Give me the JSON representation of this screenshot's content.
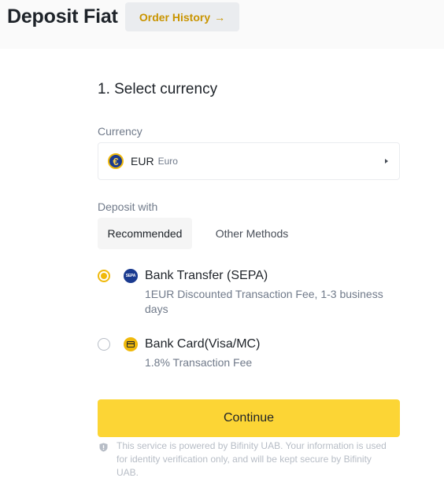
{
  "header": {
    "title": "Deposit Fiat",
    "order_history_label": "Order History",
    "order_history_arrow": "→"
  },
  "section": {
    "title": "1. Select currency"
  },
  "currency": {
    "label": "Currency",
    "coin_symbol": "€",
    "code": "EUR",
    "name": "Euro"
  },
  "deposit_with": {
    "label": "Deposit with",
    "tabs": [
      {
        "label": "Recommended",
        "active": true
      },
      {
        "label": "Other Methods",
        "active": false
      }
    ]
  },
  "methods": [
    {
      "icon": "sepa-icon",
      "icon_text": "SEPA",
      "title": "Bank Transfer (SEPA)",
      "description": "1EUR Discounted Transaction Fee, 1-3 business days",
      "selected": true
    },
    {
      "icon": "bank-card-icon",
      "title": "Bank Card(Visa/MC)",
      "description": "1.8% Transaction Fee",
      "selected": false
    }
  ],
  "continue_label": "Continue",
  "disclaimer": "This service is powered by Bifinity UAB. Your information is used for identity verification only, and will be kept secure by Bifinity UAB.",
  "colors": {
    "accent": "#f0b90b",
    "button": "#fcd535",
    "link": "#c99400",
    "text": "#1e2329",
    "muted": "#707a8a"
  }
}
